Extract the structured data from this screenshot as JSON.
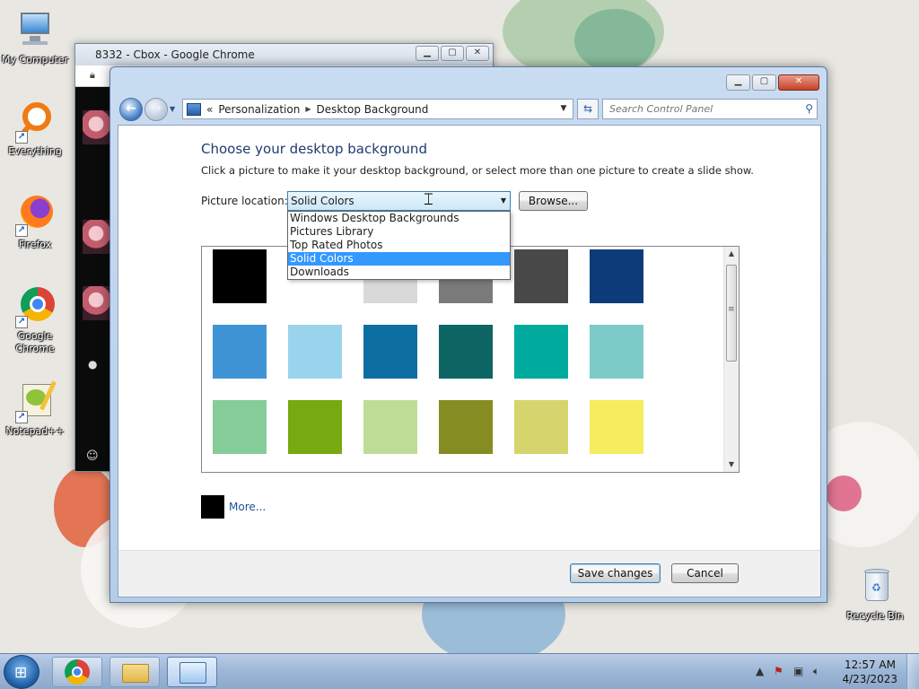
{
  "desktop": {
    "icons": [
      {
        "label": "My Computer"
      },
      {
        "label": "Everything"
      },
      {
        "label": "Firefox"
      },
      {
        "label": "Google Chrome"
      },
      {
        "label": "Notepad++"
      },
      {
        "label": "Recycle Bin"
      }
    ]
  },
  "chrome_window": {
    "title": "8332 - Cbox - Google Chrome"
  },
  "control_panel": {
    "breadcrumb": [
      "Personalization",
      "Desktop Background"
    ],
    "breadcrumb_prefix": "«",
    "search_placeholder": "Search Control Panel",
    "page_title": "Choose your desktop background",
    "description": "Click a picture to make it your desktop background, or select more than one picture to create a slide show.",
    "location_label": "Picture location:",
    "location_value": "Solid Colors",
    "browse_label": "Browse...",
    "location_options": [
      {
        "label": "Windows Desktop Backgrounds",
        "selected": false
      },
      {
        "label": "Pictures Library",
        "selected": false
      },
      {
        "label": "Top Rated Photos",
        "selected": false
      },
      {
        "label": "Solid Colors",
        "selected": true
      },
      {
        "label": "Downloads",
        "selected": false
      }
    ],
    "swatch_colors": [
      "#000000",
      "#ffffff",
      "#d9d9d9",
      "#7a7a7a",
      "#484848",
      "#0d3c7a",
      "#3f94d6",
      "#9ad3ec",
      "#0d6ea2",
      "#0d6664",
      "#00aa9c",
      "#7ccbc8",
      "#86cc98",
      "#77a911",
      "#bfdc96",
      "#858c21",
      "#d6d46c",
      "#f6ec60"
    ],
    "more_label": "More...",
    "more_color": "#000000",
    "save_label": "Save changes",
    "cancel_label": "Cancel"
  },
  "taskbar": {
    "time": "12:57 AM",
    "date": "4/23/2023"
  }
}
